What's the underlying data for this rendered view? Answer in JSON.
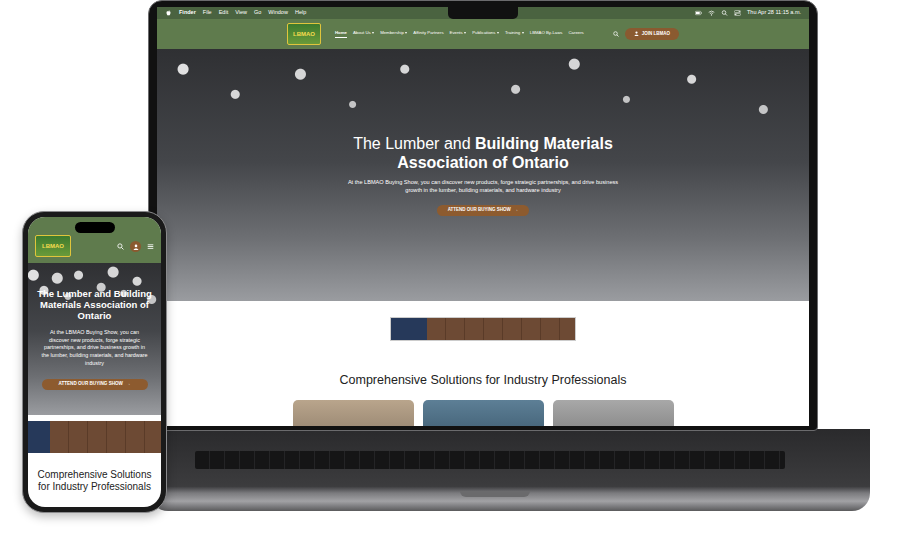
{
  "laptop": {
    "menubar": {
      "app": "Finder",
      "menus": [
        "File",
        "Edit",
        "View",
        "Go",
        "Window",
        "Help"
      ],
      "clock": "Thu Apr 28  11:15 a.m."
    },
    "site": {
      "logo": "LBMAO",
      "nav": [
        {
          "label": "Home",
          "selected": true,
          "dropdown": false
        },
        {
          "label": "About Us",
          "selected": false,
          "dropdown": true
        },
        {
          "label": "Membership",
          "selected": false,
          "dropdown": true
        },
        {
          "label": "Affinity Partners",
          "selected": false,
          "dropdown": false
        },
        {
          "label": "Events",
          "selected": false,
          "dropdown": true
        },
        {
          "label": "Publications",
          "selected": false,
          "dropdown": true
        },
        {
          "label": "Training",
          "selected": false,
          "dropdown": true
        },
        {
          "label": "LBMAO By-Laws",
          "selected": false,
          "dropdown": false
        },
        {
          "label": "Careers",
          "selected": false,
          "dropdown": false
        }
      ],
      "join": "JOIN LBMAO",
      "hero": {
        "title": [
          {
            "text": "The Lumber and",
            "bold": false
          },
          {
            "text": "Building Materials Association of Ontario",
            "bold": true
          }
        ],
        "subtitle": "At the LBMAO Buying Show, you can discover new products, forge strategic partnerships, and drive business growth in the lumber, building materials, and hardware industry",
        "cta": "ATTEND OUR BUYING SHOW",
        "cta_icon": "→"
      },
      "section_title": "Comprehensive Solutions for Industry Professionals"
    }
  },
  "phone": {
    "logo": "LBMAO",
    "hero": {
      "title": "The Lumber and Building Materials Association of Ontario",
      "subtitle": "At the LBMAO Buying Show, you can discover new products, forge strategic partnerships, and drive business growth in the lumber, building materials, and hardware industry",
      "cta": "ATTEND OUR BUYING SHOW",
      "cta_icon": "→"
    },
    "section_title": "Comprehensive Solutions for Industry Professionals"
  }
}
